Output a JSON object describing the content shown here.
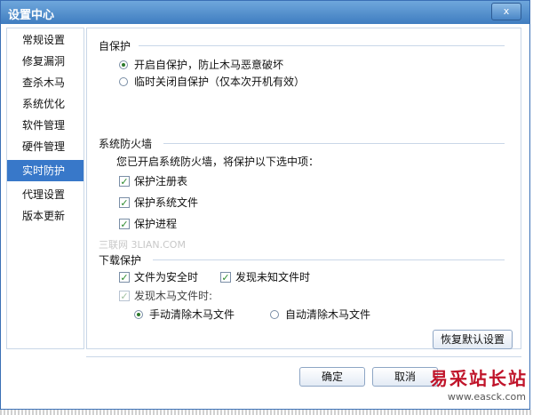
{
  "window": {
    "title": "设置中心",
    "close_label": "x"
  },
  "sidebar": {
    "items": [
      {
        "label": "常规设置"
      },
      {
        "label": "修复漏洞"
      },
      {
        "label": "查杀木马"
      },
      {
        "label": "系统优化"
      },
      {
        "label": "软件管理"
      },
      {
        "label": "硬件管理"
      },
      {
        "label": "实时防护",
        "selected": true
      },
      {
        "label": "代理设置"
      },
      {
        "label": "版本更新"
      }
    ]
  },
  "self_protect": {
    "title": "自保护",
    "options": [
      {
        "label": "开启自保护，防止木马恶意破坏",
        "checked": true
      },
      {
        "label": "临时关闭自保护（仅本次开机有效）",
        "checked": false
      }
    ]
  },
  "firewall": {
    "title": "系统防火墙",
    "description": "您已开启系统防火墙，将保护以下选中项：",
    "options": [
      {
        "label": "保护注册表",
        "checked": true
      },
      {
        "label": "保护系统文件",
        "checked": true
      },
      {
        "label": "保护进程",
        "checked": true
      }
    ]
  },
  "watermark": "三联网 3LIAN.COM",
  "download": {
    "title": "下载保护",
    "safe_file": {
      "label": "文件为安全时",
      "checked": true
    },
    "unknown_file": {
      "label": "发现未知文件时",
      "checked": true
    },
    "trojan_file": {
      "label": "发现木马文件时:",
      "checked": true,
      "disabled": true
    },
    "manual_clean": {
      "label": "手动清除木马文件",
      "checked": true
    },
    "auto_clean": {
      "label": "自动清除木马文件",
      "checked": false
    }
  },
  "buttons": {
    "restore_default": "恢复默认设置",
    "ok": "确定",
    "cancel": "取消"
  },
  "brand": {
    "name": "易采站长站",
    "url": "www.easck.com"
  },
  "colors": {
    "accent": "#3878c9",
    "titlebar": "#4f8ccc",
    "brand": "#c0142a"
  }
}
